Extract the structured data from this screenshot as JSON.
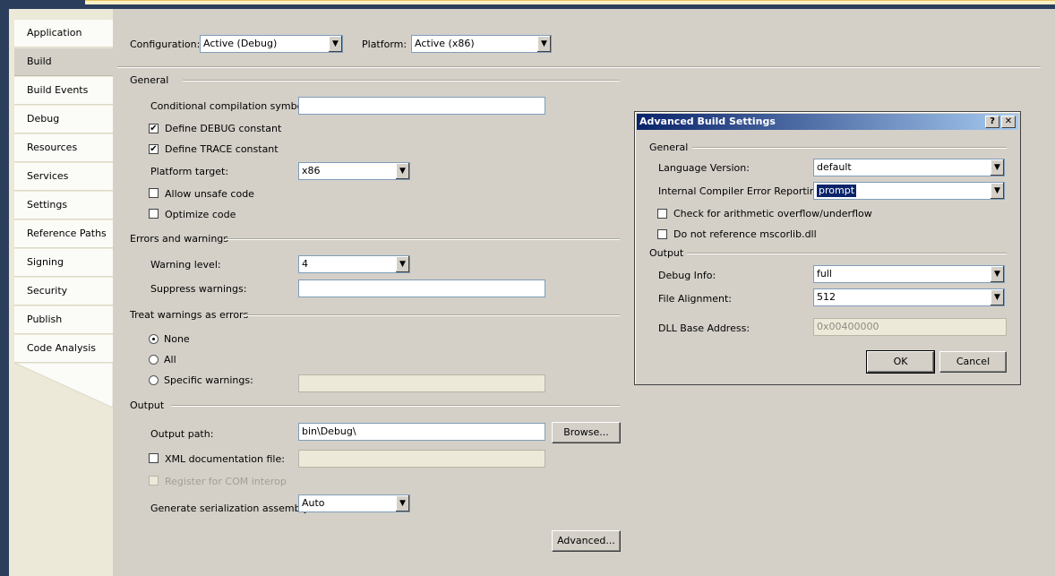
{
  "sidebar": {
    "items": [
      {
        "label": "Application",
        "name": "sidebar-item-application"
      },
      {
        "label": "Build",
        "name": "sidebar-item-build"
      },
      {
        "label": "Build Events",
        "name": "sidebar-item-build-events"
      },
      {
        "label": "Debug",
        "name": "sidebar-item-debug"
      },
      {
        "label": "Resources",
        "name": "sidebar-item-resources"
      },
      {
        "label": "Services",
        "name": "sidebar-item-services"
      },
      {
        "label": "Settings",
        "name": "sidebar-item-settings"
      },
      {
        "label": "Reference Paths",
        "name": "sidebar-item-reference-paths"
      },
      {
        "label": "Signing",
        "name": "sidebar-item-signing"
      },
      {
        "label": "Security",
        "name": "sidebar-item-security"
      },
      {
        "label": "Publish",
        "name": "sidebar-item-publish"
      },
      {
        "label": "Code Analysis",
        "name": "sidebar-item-code-analysis"
      }
    ],
    "active_index": 1
  },
  "top": {
    "configuration_label": "Configuration:",
    "configuration_value": "Active (Debug)",
    "platform_label": "Platform:",
    "platform_value": "Active (x86)"
  },
  "general": {
    "title": "General",
    "symbols_label": "Conditional compilation symbols:",
    "symbols_value": "",
    "define_debug": {
      "label": "Define DEBUG constant",
      "checked": "✔"
    },
    "define_trace": {
      "label": "Define TRACE constant",
      "checked": "✔"
    },
    "platform_target_label": "Platform target:",
    "platform_target_value": "x86",
    "allow_unsafe": {
      "label": "Allow unsafe code",
      "checked": ""
    },
    "optimize": {
      "label": "Optimize code",
      "checked": ""
    }
  },
  "errors": {
    "title": "Errors and warnings",
    "warning_level_label": "Warning level:",
    "warning_level_value": "4",
    "suppress_label": "Suppress warnings:",
    "suppress_value": ""
  },
  "treat": {
    "title": "Treat warnings as errors",
    "none_label": "None",
    "all_label": "All",
    "specific_label": "Specific warnings:",
    "specific_value": ""
  },
  "output": {
    "title": "Output",
    "path_label": "Output path:",
    "path_value": "bin\\Debug\\",
    "browse_label": "Browse...",
    "xml_label": "XML documentation file:",
    "xml_value": "",
    "com_label": "Register for COM interop",
    "serialization_label": "Generate serialization assembly:",
    "serialization_value": "Auto",
    "advanced_label": "Advanced..."
  },
  "dialog": {
    "title": "Advanced Build Settings",
    "help_glyph": "?",
    "close_glyph": "✕",
    "general_title": "General",
    "lang_label": "Language Version:",
    "lang_value": "default",
    "ice_label": "Internal Compiler Error Reporting:",
    "ice_value": "prompt",
    "overflow_label": "Check for arithmetic overflow/underflow",
    "mscorlib_label": "Do not reference mscorlib.dll",
    "output_title": "Output",
    "debug_info_label": "Debug Info:",
    "debug_info_value": "full",
    "file_align_label": "File Alignment:",
    "file_align_value": "512",
    "dll_base_label": "DLL Base Address:",
    "dll_base_value": "0x00400000",
    "ok_label": "OK",
    "cancel_label": "Cancel"
  },
  "glyphs": {
    "dropdown_arrow": "▼"
  }
}
